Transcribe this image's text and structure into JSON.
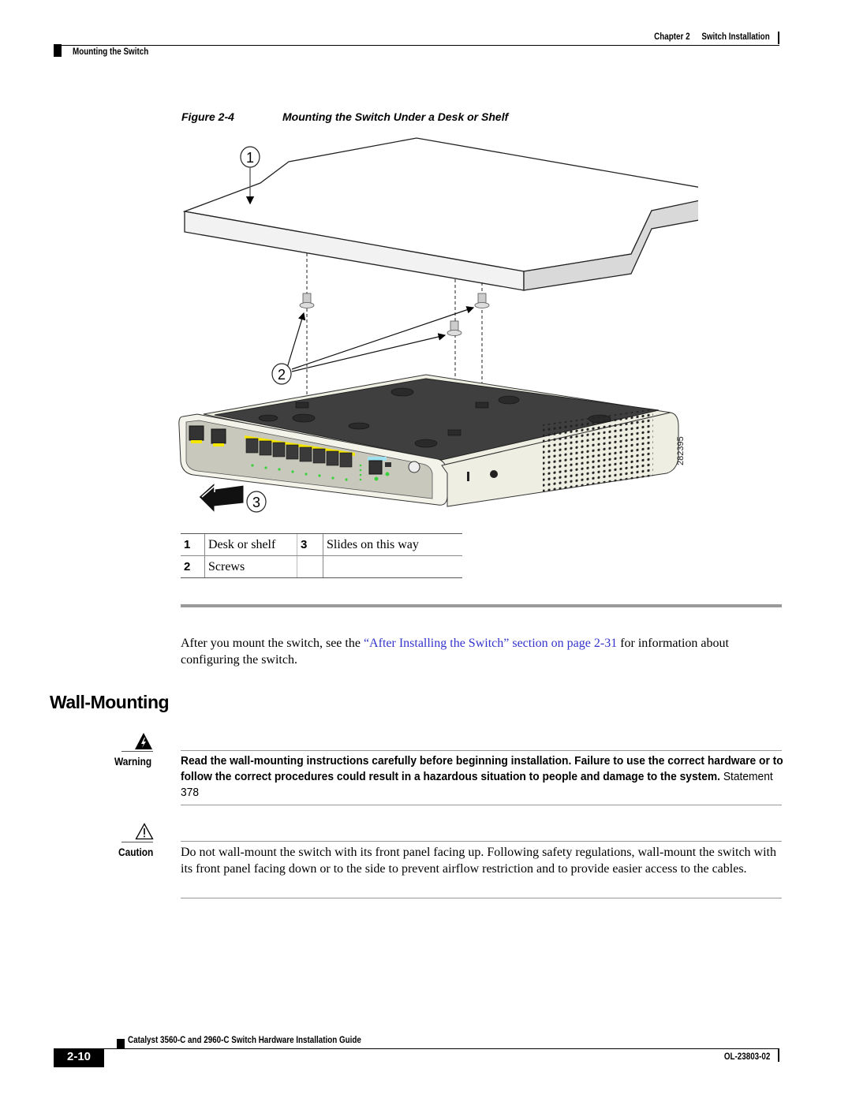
{
  "header": {
    "chapter_label": "Chapter 2",
    "chapter_title": "Switch Installation",
    "section": "Mounting the Switch"
  },
  "figure": {
    "number": "Figure 2-4",
    "title": "Mounting the Switch Under a Desk or Shelf",
    "callouts": [
      "1",
      "2",
      "3"
    ],
    "art_id": "282395",
    "legend": [
      {
        "num": "1",
        "text": "Desk or shelf",
        "num2": "3",
        "text2": "Slides on this way"
      },
      {
        "num": "2",
        "text": "Screws",
        "num2": "",
        "text2": ""
      }
    ],
    "colors": {
      "shelf_side": "#f2f2f2",
      "shelf_edge": "#d9d9d9",
      "switch_top": "#3f3f3f",
      "switch_body": "#eeeee2",
      "front_panel": "#c8c8bd",
      "port_highlight": "#f5e600",
      "led_green": "#3bd13b"
    }
  },
  "body": {
    "para_before": "After you mount the switch, see the ",
    "link_text": "“After Installing the Switch” section on page 2-31",
    "para_after": " for information about configuring the switch.",
    "link_color": "#3333cc"
  },
  "section": {
    "heading": "Wall-Mounting"
  },
  "warning": {
    "label": "Warning",
    "icon": "warning-lightning-icon",
    "text": "Read the wall-mounting instructions carefully before beginning installation. Failure to use the correct hardware or to follow the correct procedures could result in a hazardous situation to people and damage to the system.",
    "statement": " Statement 378"
  },
  "caution": {
    "label": "Caution",
    "icon": "caution-triangle-icon",
    "text": "Do not wall-mount the switch with its front panel facing up. Following safety regulations, wall-mount the switch with its front panel facing down or to the side to prevent airflow restriction and to provide easier access to the cables."
  },
  "footer": {
    "guide_title": "Catalyst 3560-C and 2960-C Switch Hardware Installation Guide",
    "page_number": "2-10",
    "doc_number": "OL-23803-02"
  }
}
